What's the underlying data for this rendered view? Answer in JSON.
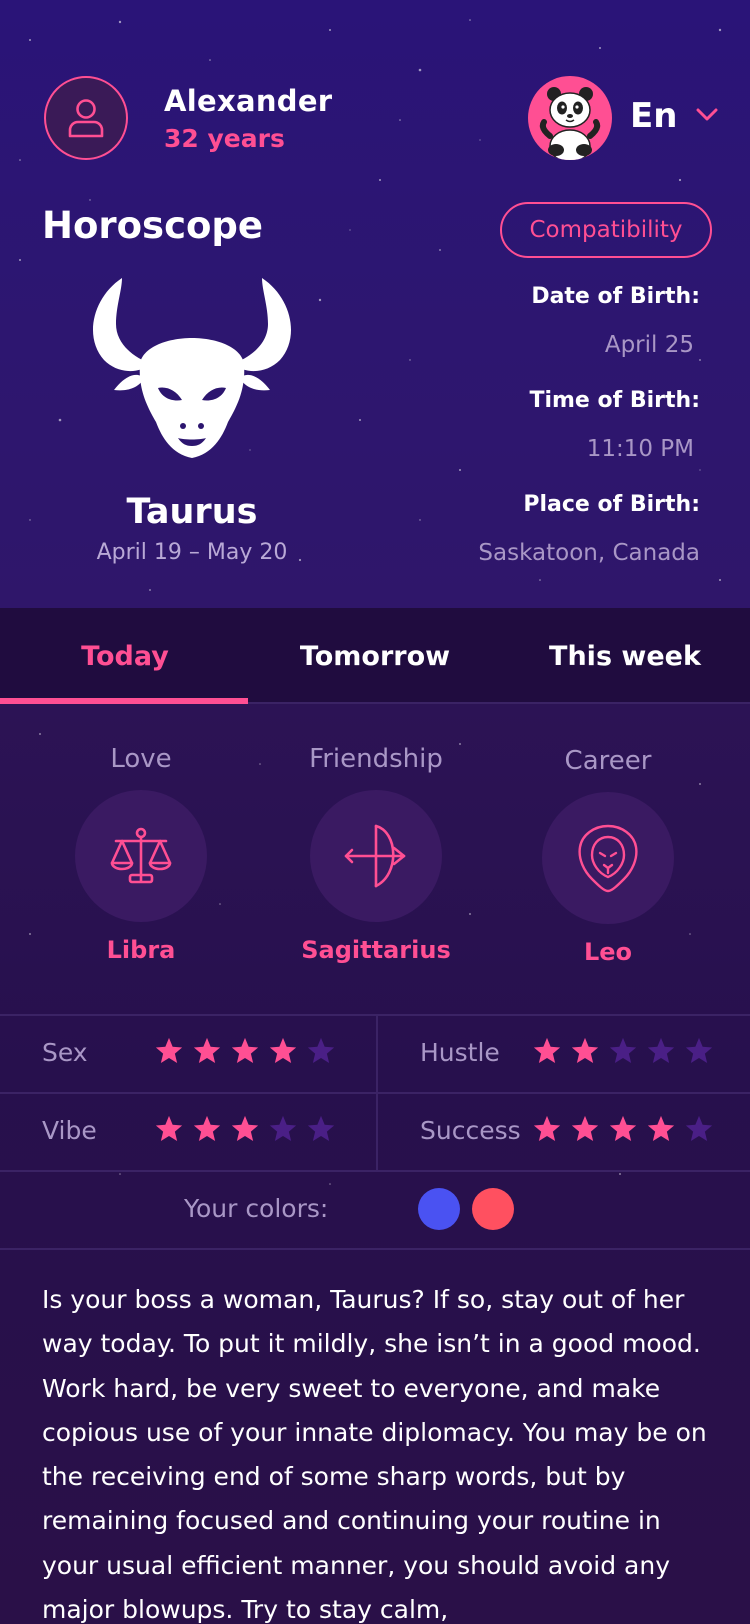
{
  "user": {
    "name": "Alexander",
    "age": "32 years"
  },
  "language": {
    "code": "En"
  },
  "header": {
    "title": "Horoscope",
    "compatibility_button": "Compatibility"
  },
  "sign": {
    "name": "Taurus",
    "dates": "April 19 – May 20"
  },
  "birth": {
    "date_label": "Date of Birth:",
    "date_value": "April 25",
    "time_label": "Time of Birth:",
    "time_value": "11:10 PM",
    "place_label": "Place of Birth:",
    "place_value": "Saskatoon, Canada"
  },
  "tabs": [
    {
      "label": "Today",
      "active": true
    },
    {
      "label": "Tomorrow",
      "active": false
    },
    {
      "label": "This week",
      "active": false
    }
  ],
  "compatibility": [
    {
      "category": "Love",
      "sign": "Libra",
      "icon": "libra-icon"
    },
    {
      "category": "Friendship",
      "sign": "Sagittarius",
      "icon": "sagittarius-icon"
    },
    {
      "category": "Career",
      "sign": "Leo",
      "icon": "leo-icon"
    }
  ],
  "ratings": [
    {
      "label": "Sex",
      "score": 4,
      "max": 5
    },
    {
      "label": "Hustle",
      "score": 2,
      "max": 5
    },
    {
      "label": "Vibe",
      "score": 3,
      "max": 5
    },
    {
      "label": "Success",
      "score": 4,
      "max": 5
    }
  ],
  "colors": {
    "label": "Your colors:",
    "values": [
      "#4a52f2",
      "#ff5060"
    ]
  },
  "horoscope_text": "Is your boss a woman, Taurus? If so, stay out of her way today. To put it mildly, she isn’t in a good mood. Work hard, be very sweet to everyone, and make copious use of your innate diplomacy. You may be on the receiving end of some sharp words, but by remaining focused and continuing your routine in your usual efficient manner, you should avoid any major blowups. Try to stay calm,",
  "theme": {
    "accent": "#ff4f93",
    "star_off": "#4a1f86",
    "muted": "#a997c6"
  }
}
